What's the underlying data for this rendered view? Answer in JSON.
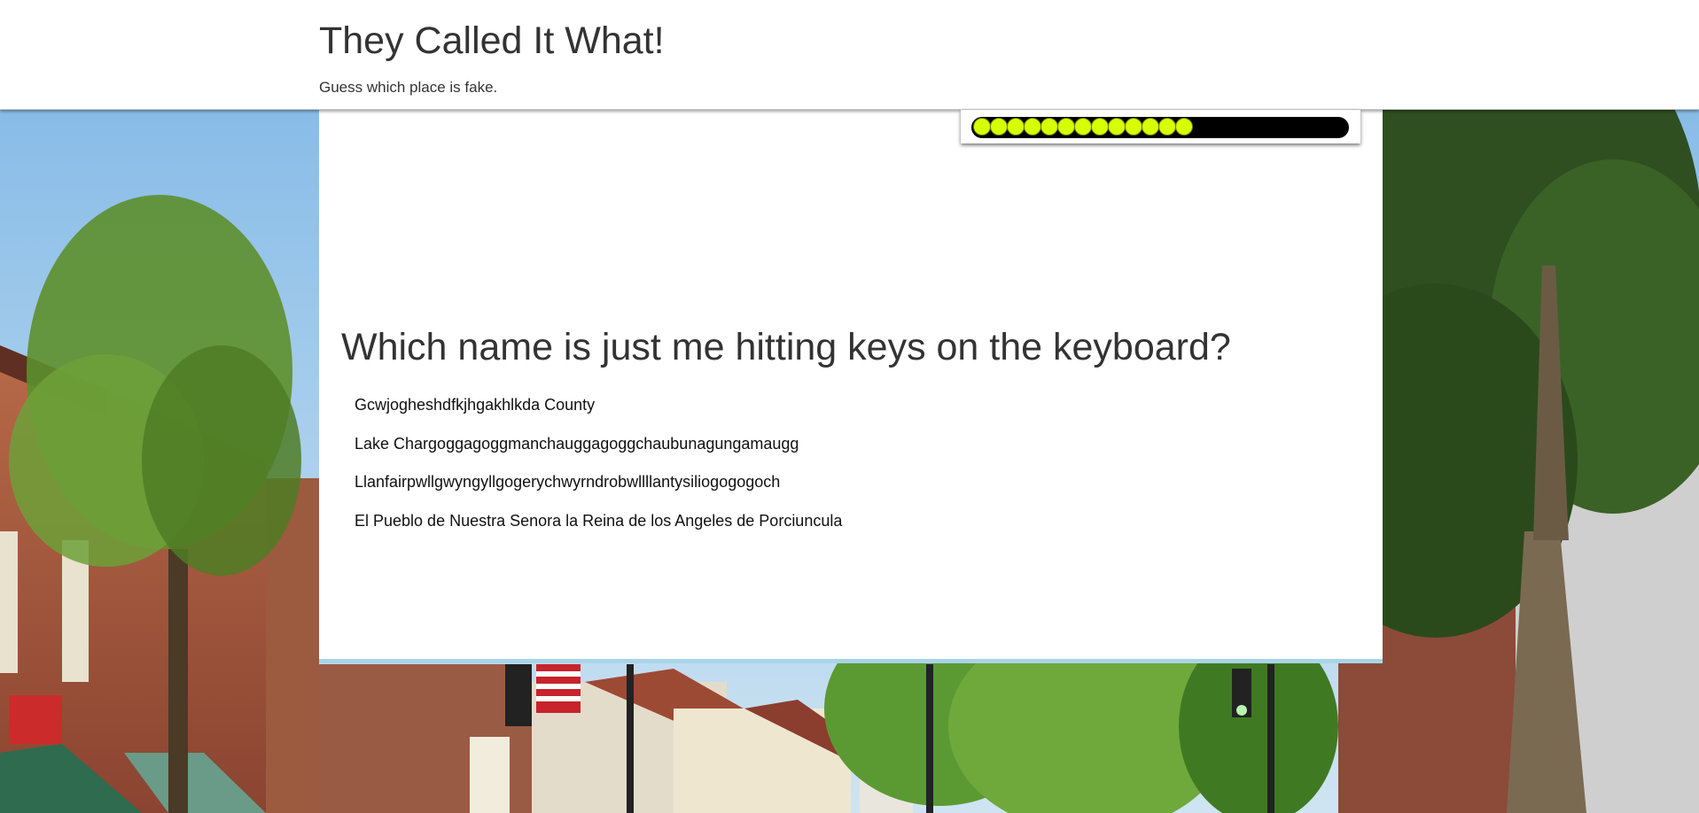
{
  "header": {
    "title": "They Called It What!",
    "subtitle": "Guess which place is fake."
  },
  "progress": {
    "filled_dots": 13,
    "fraction": 0.6,
    "fill_color": "#d7ff00",
    "track_color": "#000000"
  },
  "question": {
    "text": "Which name is just me hitting keys on the keyboard?",
    "answers": [
      "Gcwjogheshdfkjhgakhlkda County",
      "Lake Chargoggagoggmanchauggagoggchaubunagungamaugg",
      "Llanfairpwllgwyngyllgogerychwyrndrobwllllantysiliogogogoch",
      "El Pueblo de Nuestra Senora la Reina de los Angeles de Porciuncula"
    ]
  },
  "colors": {
    "card_border": "#a9d4e8",
    "text": "#333333"
  }
}
